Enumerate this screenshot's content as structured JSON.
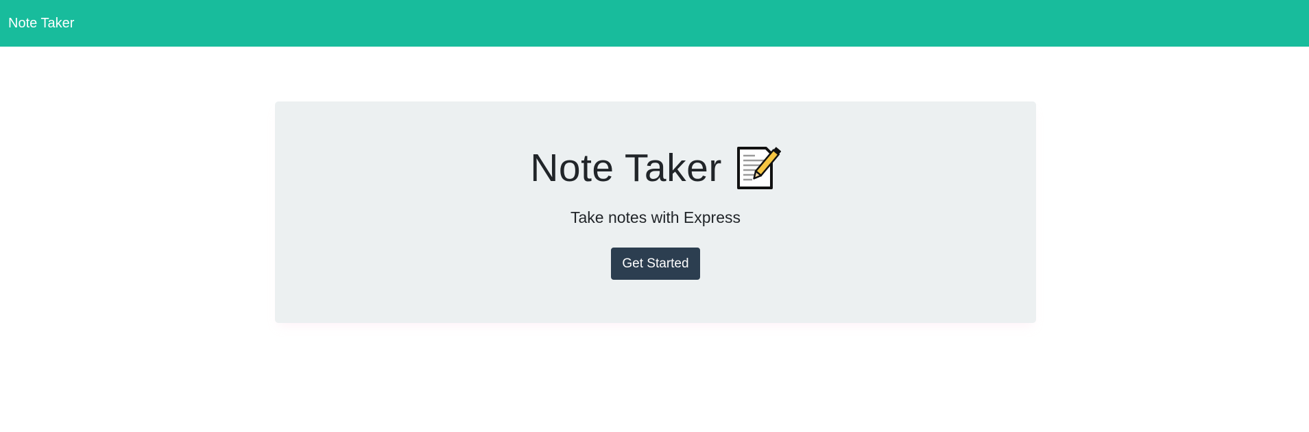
{
  "navbar": {
    "brand": "Note Taker",
    "color": "#18bc9c"
  },
  "hero": {
    "title": "Note Taker",
    "icon": "memo-icon",
    "subtitle": "Take notes with Express",
    "button_label": "Get Started",
    "background": "#ecf0f1",
    "button_color": "#2c3e50"
  }
}
